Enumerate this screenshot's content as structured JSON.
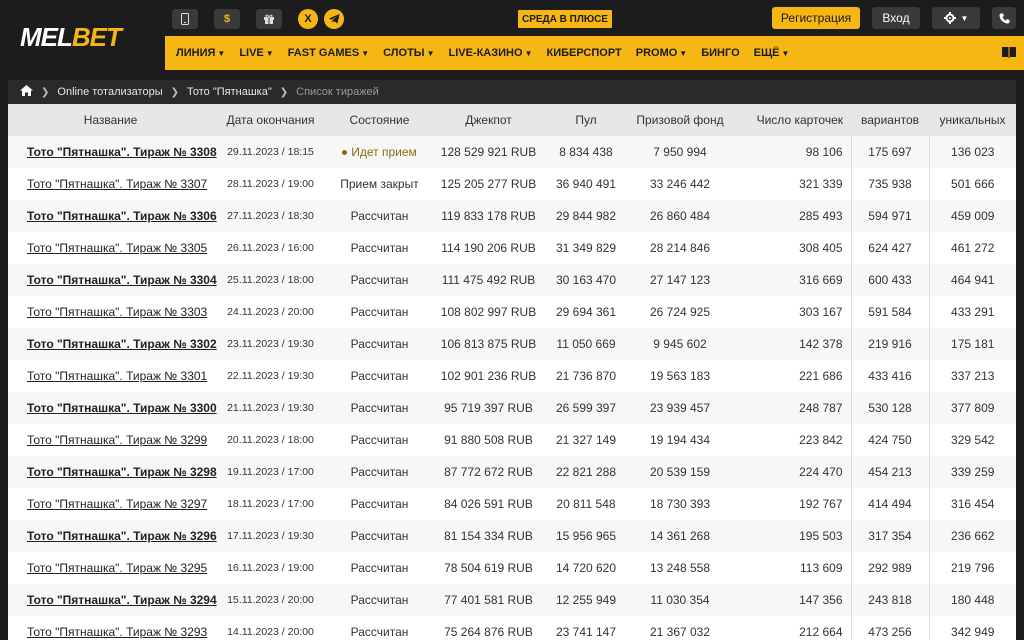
{
  "brand": {
    "part1": "MEL",
    "part2": "BET"
  },
  "topbar": {
    "mobile_icon": "mobile-icon",
    "dollar_label": "$",
    "gift_icon": "gift-icon",
    "x_label": "X",
    "telegram_icon": "telegram-icon",
    "promo_badge": "СРЕДА В ПЛЮСЕ",
    "register_label": "Регистрация",
    "login_label": "Вход",
    "settings_icon": "gear-icon",
    "phone_icon": "phone-icon"
  },
  "nav": {
    "items": [
      {
        "label": "ЛИНИЯ",
        "dropdown": true
      },
      {
        "label": "LIVE",
        "dropdown": true
      },
      {
        "label": "FAST GAMES",
        "dropdown": true
      },
      {
        "label": "СЛОТЫ",
        "dropdown": true
      },
      {
        "label": "LIVE-КАЗИНО",
        "dropdown": true
      },
      {
        "label": "КИБЕРСПОРТ",
        "dropdown": false
      },
      {
        "label": "PROMO",
        "dropdown": true
      },
      {
        "label": "БИНГО",
        "dropdown": false
      },
      {
        "label": "ЕЩЁ",
        "dropdown": true
      }
    ],
    "book_icon": "book-icon"
  },
  "breadcrumb": {
    "home_icon": "home-icon",
    "items": [
      "Online тотализаторы",
      "Тото \"Пятнашка\"",
      "Список тиражей"
    ]
  },
  "table": {
    "headers": [
      "Название",
      "Дата окончания",
      "Состояние",
      "Джекпот",
      "Пул",
      "Призовой фонд",
      "Число карточек",
      "вариантов",
      "уникальных"
    ],
    "rows": [
      {
        "name": "Тото \"Пятнашка\". Тираж № 3308",
        "date": "29.11.2023 / 18:15",
        "state": "Идет прием",
        "jackpot": "128 529 921 RUB",
        "pool": "8 834 438",
        "fund": "7 950 994",
        "cards": "98 106",
        "variants": "175 697",
        "unique": "136 023"
      },
      {
        "name": "Тото \"Пятнашка\". Тираж № 3307",
        "date": "28.11.2023 / 19:00",
        "state": "Прием закрыт",
        "jackpot": "125 205 277 RUB",
        "pool": "36 940 491",
        "fund": "33 246 442",
        "cards": "321 339",
        "variants": "735 938",
        "unique": "501 666"
      },
      {
        "name": "Тото \"Пятнашка\". Тираж № 3306",
        "date": "27.11.2023 / 18:30",
        "state": "Рассчитан",
        "jackpot": "119 833 178 RUB",
        "pool": "29 844 982",
        "fund": "26 860 484",
        "cards": "285 493",
        "variants": "594 971",
        "unique": "459 009"
      },
      {
        "name": "Тото \"Пятнашка\". Тираж № 3305",
        "date": "26.11.2023 / 16:00",
        "state": "Рассчитан",
        "jackpot": "114 190 206 RUB",
        "pool": "31 349 829",
        "fund": "28 214 846",
        "cards": "308 405",
        "variants": "624 427",
        "unique": "461 272"
      },
      {
        "name": "Тото \"Пятнашка\". Тираж № 3304",
        "date": "25.11.2023 / 18:00",
        "state": "Рассчитан",
        "jackpot": "111 475 492 RUB",
        "pool": "30 163 470",
        "fund": "27 147 123",
        "cards": "316 669",
        "variants": "600 433",
        "unique": "464 941"
      },
      {
        "name": "Тото \"Пятнашка\". Тираж № 3303",
        "date": "24.11.2023 / 20:00",
        "state": "Рассчитан",
        "jackpot": "108 802 997 RUB",
        "pool": "29 694 361",
        "fund": "26 724 925",
        "cards": "303 167",
        "variants": "591 584",
        "unique": "433 291"
      },
      {
        "name": "Тото \"Пятнашка\". Тираж № 3302",
        "date": "23.11.2023 / 19:30",
        "state": "Рассчитан",
        "jackpot": "106 813 875 RUB",
        "pool": "11 050 669",
        "fund": "9 945 602",
        "cards": "142 378",
        "variants": "219 916",
        "unique": "175 181"
      },
      {
        "name": "Тото \"Пятнашка\". Тираж № 3301",
        "date": "22.11.2023 / 19:30",
        "state": "Рассчитан",
        "jackpot": "102 901 236 RUB",
        "pool": "21 736 870",
        "fund": "19 563 183",
        "cards": "221 686",
        "variants": "433 416",
        "unique": "337 213"
      },
      {
        "name": "Тото \"Пятнашка\". Тираж № 3300",
        "date": "21.11.2023 / 19:30",
        "state": "Рассчитан",
        "jackpot": "95 719 397 RUB",
        "pool": "26 599 397",
        "fund": "23 939 457",
        "cards": "248 787",
        "variants": "530 128",
        "unique": "377 809"
      },
      {
        "name": "Тото \"Пятнашка\". Тираж № 3299",
        "date": "20.11.2023 / 18:00",
        "state": "Рассчитан",
        "jackpot": "91 880 508 RUB",
        "pool": "21 327 149",
        "fund": "19 194 434",
        "cards": "223 842",
        "variants": "424 750",
        "unique": "329 542"
      },
      {
        "name": "Тото \"Пятнашка\". Тираж № 3298",
        "date": "19.11.2023 / 17:00",
        "state": "Рассчитан",
        "jackpot": "87 772 672 RUB",
        "pool": "22 821 288",
        "fund": "20 539 159",
        "cards": "224 470",
        "variants": "454 213",
        "unique": "339 259"
      },
      {
        "name": "Тото \"Пятнашка\". Тираж № 3297",
        "date": "18.11.2023 / 17:00",
        "state": "Рассчитан",
        "jackpot": "84 026 591 RUB",
        "pool": "20 811 548",
        "fund": "18 730 393",
        "cards": "192 767",
        "variants": "414 494",
        "unique": "316 454"
      },
      {
        "name": "Тото \"Пятнашка\". Тираж № 3296",
        "date": "17.11.2023 / 19:30",
        "state": "Рассчитан",
        "jackpot": "81 154 334 RUB",
        "pool": "15 956 965",
        "fund": "14 361 268",
        "cards": "195 503",
        "variants": "317 354",
        "unique": "236 662"
      },
      {
        "name": "Тото \"Пятнашка\". Тираж № 3295",
        "date": "16.11.2023 / 19:00",
        "state": "Рассчитан",
        "jackpot": "78 504 619 RUB",
        "pool": "14 720 620",
        "fund": "13 248 558",
        "cards": "113 609",
        "variants": "292 989",
        "unique": "219 796"
      },
      {
        "name": "Тото \"Пятнашка\". Тираж № 3294",
        "date": "15.11.2023 / 20:00",
        "state": "Рассчитан",
        "jackpot": "77 401 581 RUB",
        "pool": "12 255 949",
        "fund": "11 030 354",
        "cards": "147 356",
        "variants": "243 818",
        "unique": "180 448"
      },
      {
        "name": "Тото \"Пятнашка\". Тираж № 3293",
        "date": "14.11.2023 / 20:00",
        "state": "Рассчитан",
        "jackpot": "75 264 876 RUB",
        "pool": "23 741 147",
        "fund": "21 367 032",
        "cards": "212 664",
        "variants": "473 256",
        "unique": "342 949"
      }
    ]
  }
}
